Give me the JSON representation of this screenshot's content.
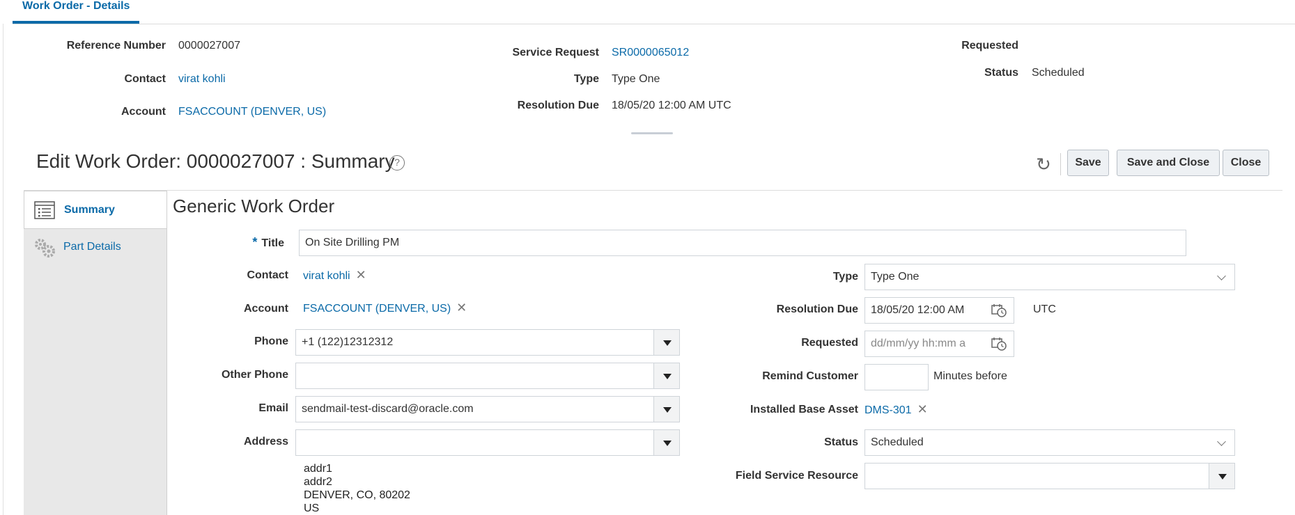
{
  "tab": {
    "label": "Work Order - Details"
  },
  "header": {
    "reference_number_label": "Reference Number",
    "reference_number": "0000027007",
    "contact_label": "Contact",
    "contact": "virat kohli",
    "account_label": "Account",
    "account": "FSACCOUNT (DENVER, US)",
    "service_request_label": "Service Request",
    "service_request": "SR0000065012",
    "type_label": "Type",
    "type": "Type One",
    "resolution_due_label": "Resolution Due",
    "resolution_due": "18/05/20 12:00 AM UTC",
    "requested_label": "Requested",
    "requested": "",
    "status_label": "Status",
    "status": "Scheduled"
  },
  "page": {
    "title": "Edit Work Order: 0000027007 : Summary",
    "help_icon": "?"
  },
  "toolbar": {
    "undo_icon": "↻",
    "save_label": "Save",
    "save_close_label": "Save and Close",
    "close_label": "Close"
  },
  "nav": {
    "items": [
      {
        "label": "Summary",
        "icon": "list-icon"
      },
      {
        "label": "Part Details",
        "icon": "gears-icon"
      }
    ]
  },
  "form": {
    "section_title": "Generic Work Order",
    "required_mark": "*",
    "title_label": "Title",
    "title_value": "On Site Drilling PM",
    "contact_label": "Contact",
    "contact_value": "virat kohli",
    "account_label": "Account",
    "account_value": "FSACCOUNT (DENVER, US)",
    "phone_label": "Phone",
    "phone_value": "+1 (122)12312312",
    "other_phone_label": "Other Phone",
    "other_phone_value": "",
    "email_label": "Email",
    "email_value": "sendmail-test-discard@oracle.com",
    "address_label": "Address",
    "address_value": "",
    "address_lines": [
      "addr1",
      "addr2",
      "DENVER, CO, 80202",
      "US"
    ],
    "type_label": "Type",
    "type_value": "Type One",
    "resolution_due_label": "Resolution Due",
    "resolution_due_value": "18/05/20 12:00 AM",
    "timezone": "UTC",
    "requested_label": "Requested",
    "requested_placeholder": "dd/mm/yy hh:mm a",
    "remind_label": "Remind Customer",
    "remind_value": "",
    "remind_suffix": "Minutes before",
    "asset_label": "Installed Base Asset",
    "asset_value": "DMS-301",
    "status_label": "Status",
    "status_value": "Scheduled",
    "fsr_label": "Field Service Resource",
    "fsr_value": "",
    "clear_icon": "✕"
  }
}
